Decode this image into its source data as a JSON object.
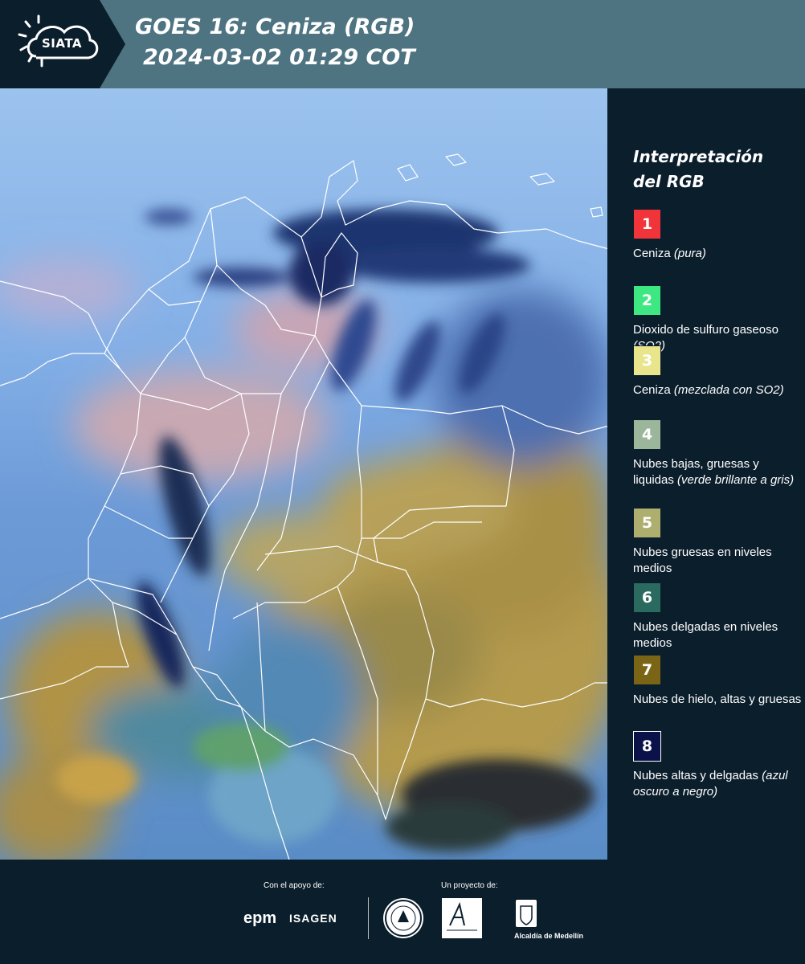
{
  "header": {
    "logo_text": "SIATA",
    "title": "GOES 16: Ceniza (RGB)",
    "subtitle": "2024-03-02 01:29 COT"
  },
  "legend": {
    "title": "Interpretación del RGB",
    "items": [
      {
        "number": "1",
        "color": "#f1333a",
        "label": "Ceniza",
        "note": "(pura)"
      },
      {
        "number": "2",
        "color": "#3de882",
        "label": "Dioxido de sulfuro gaseoso",
        "note": "(SO2)"
      },
      {
        "number": "3",
        "color": "#e9e58d",
        "label": "Ceniza",
        "note": "(mezclada con SO2)"
      },
      {
        "number": "4",
        "color": "#9cb69b",
        "label": "Nubes bajas, gruesas y liquidas",
        "note": "(verde brillante a gris)"
      },
      {
        "number": "5",
        "color": "#aeae6f",
        "label": "Nubes gruesas en niveles medios",
        "note": ""
      },
      {
        "number": "6",
        "color": "#2b6a5f",
        "label": "Nubes delgadas en niveles medios",
        "note": ""
      },
      {
        "number": "7",
        "color": "#7a6415",
        "label": "Nubes de hielo, altas y gruesas",
        "note": ""
      },
      {
        "number": "8",
        "color": "#0a1249",
        "label": "Nubes altas y delgadas",
        "note": "(azul oscuro a negro)"
      }
    ]
  },
  "footer": {
    "support_label": "Con el apoyo de:",
    "project_label": "Un proyecto de:",
    "sponsors": [
      "epm",
      "ISAGEN"
    ],
    "partners": [
      "Área Metropolitana Valle de Aburrá",
      "Alcaldía de Medellín"
    ],
    "alcaldia_text": "Alcaldía de Medellín"
  },
  "map": {
    "colors": {
      "blue_light": "#8fb6e8",
      "blue_mid": "#5f8fd6",
      "blue_dark": "#17285c",
      "ochre": "#b39a4e",
      "ochre_dark": "#8a7232",
      "pink": "#c7a5b5",
      "teal": "#4f8aa0",
      "border": "#ffffff"
    }
  }
}
